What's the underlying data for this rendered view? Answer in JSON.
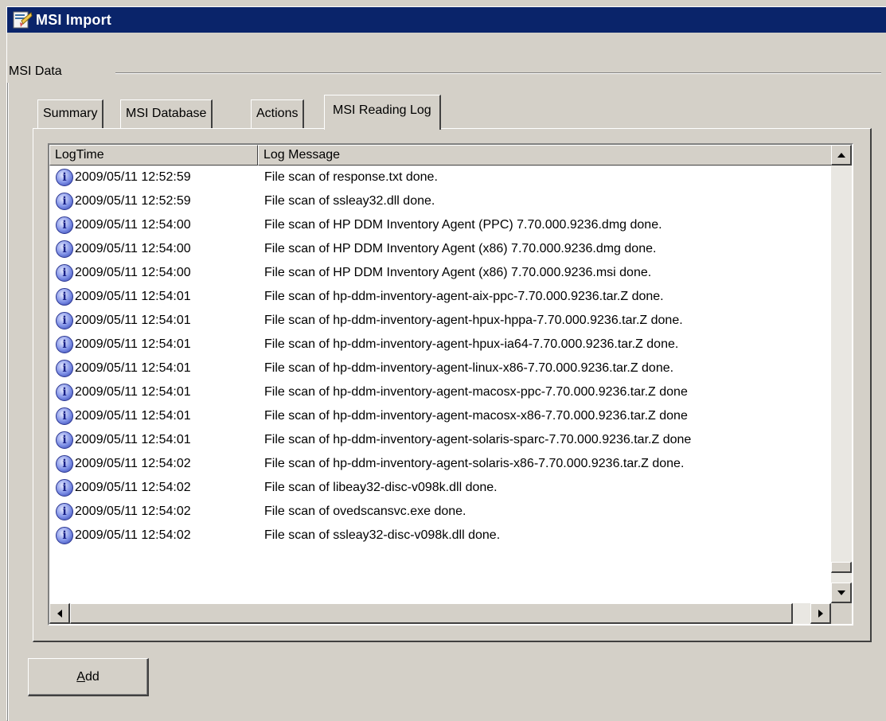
{
  "window": {
    "title": "MSI Import",
    "icon": "installer-icon"
  },
  "group": {
    "label": "MSI Data"
  },
  "tabs": [
    {
      "label": "Summary",
      "active": false
    },
    {
      "label": "MSI Database",
      "active": false
    },
    {
      "label": "Actions",
      "active": false
    },
    {
      "label": "MSI Reading Log",
      "active": true
    }
  ],
  "log": {
    "columns": [
      "LogTime",
      "Log Message"
    ],
    "rows": [
      {
        "time": "2009/05/11 12:52:59",
        "message": "File scan of response.txt done."
      },
      {
        "time": "2009/05/11 12:52:59",
        "message": "File scan of ssleay32.dll done."
      },
      {
        "time": "2009/05/11 12:54:00",
        "message": "File scan of HP DDM Inventory Agent (PPC) 7.70.000.9236.dmg done."
      },
      {
        "time": "2009/05/11 12:54:00",
        "message": "File scan of HP DDM Inventory Agent (x86) 7.70.000.9236.dmg done."
      },
      {
        "time": "2009/05/11 12:54:00",
        "message": "File scan of HP DDM Inventory Agent (x86) 7.70.000.9236.msi done."
      },
      {
        "time": "2009/05/11 12:54:01",
        "message": "File scan of hp-ddm-inventory-agent-aix-ppc-7.70.000.9236.tar.Z done."
      },
      {
        "time": "2009/05/11 12:54:01",
        "message": "File scan of hp-ddm-inventory-agent-hpux-hppa-7.70.000.9236.tar.Z done."
      },
      {
        "time": "2009/05/11 12:54:01",
        "message": "File scan of hp-ddm-inventory-agent-hpux-ia64-7.70.000.9236.tar.Z done."
      },
      {
        "time": "2009/05/11 12:54:01",
        "message": "File scan of hp-ddm-inventory-agent-linux-x86-7.70.000.9236.tar.Z done."
      },
      {
        "time": "2009/05/11 12:54:01",
        "message": "File scan of hp-ddm-inventory-agent-macosx-ppc-7.70.000.9236.tar.Z done"
      },
      {
        "time": "2009/05/11 12:54:01",
        "message": "File scan of hp-ddm-inventory-agent-macosx-x86-7.70.000.9236.tar.Z done"
      },
      {
        "time": "2009/05/11 12:54:01",
        "message": "File scan of hp-ddm-inventory-agent-solaris-sparc-7.70.000.9236.tar.Z done"
      },
      {
        "time": "2009/05/11 12:54:02",
        "message": "File scan of hp-ddm-inventory-agent-solaris-x86-7.70.000.9236.tar.Z done."
      },
      {
        "time": "2009/05/11 12:54:02",
        "message": "File scan of libeay32-disc-v098k.dll done."
      },
      {
        "time": "2009/05/11 12:54:02",
        "message": "File scan of ovedscansvc.exe done."
      },
      {
        "time": "2009/05/11 12:54:02",
        "message": "File scan of ssleay32-disc-v098k.dll done."
      }
    ],
    "row_icon": "info-icon"
  },
  "buttons": {
    "add_mnemonic": "A",
    "add_rest": "dd"
  }
}
